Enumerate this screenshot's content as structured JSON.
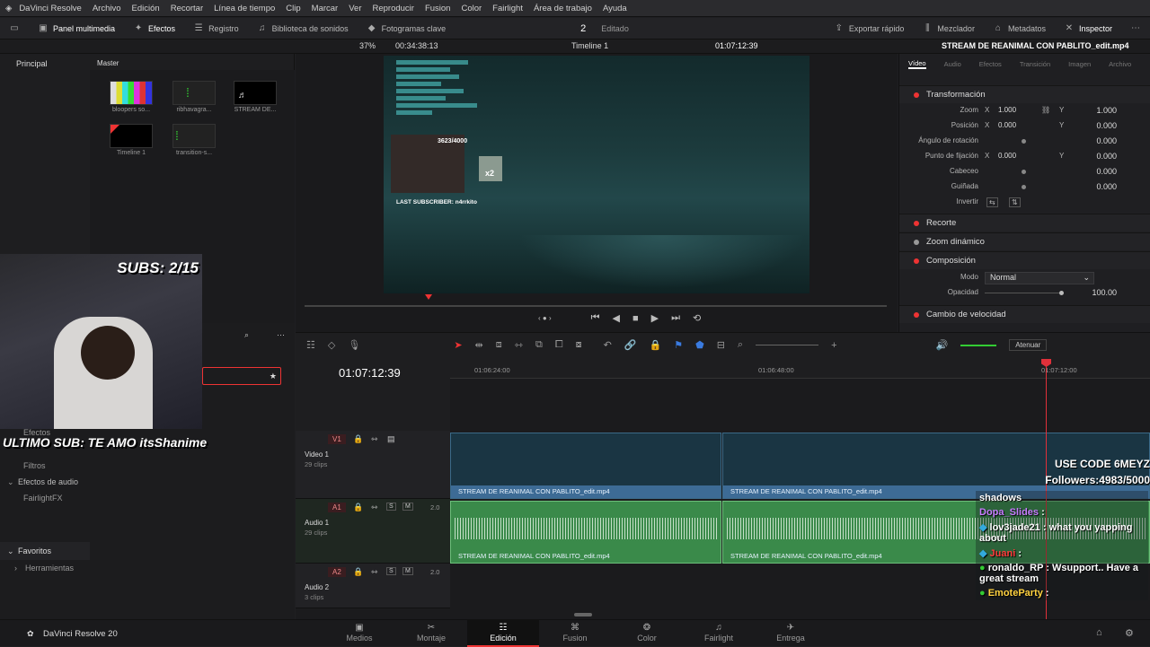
{
  "menu": [
    "DaVinci Resolve",
    "Archivo",
    "Edición",
    "Recortar",
    "Línea de tiempo",
    "Clip",
    "Marcar",
    "Ver",
    "Reproducir",
    "Fusion",
    "Color",
    "Fairlight",
    "Área de trabajo",
    "Ayuda"
  ],
  "toolbar": {
    "media_pool": "Panel multimedia",
    "effects": "Efectos",
    "log": "Registro",
    "sound_lib": "Biblioteca de sonidos",
    "keyframes": "Fotogramas clave",
    "count": "2",
    "status": "Editado",
    "quick_export": "Exportar rápido",
    "mixer": "Mezclador",
    "metadata": "Metadatos",
    "inspector": "Inspector"
  },
  "viewer": {
    "zoom": "37%",
    "duration": "00:34:38:13",
    "timeline_name": "Timeline 1",
    "timecode": "01:07:12:39",
    "clip_name": "STREAM DE REANIMAL CON PABLITO_edit.mp4"
  },
  "mediapool": {
    "tab_main": "Principal",
    "tab_master": "Master",
    "items": [
      "bloopers so...",
      "ribhavagra...",
      "STREAM DE...",
      "Timeline 1",
      "transition-s..."
    ]
  },
  "effects_panel": {
    "items": [
      "Efectos",
      "Filtros",
      "Efectos de audio",
      "FairlightFX"
    ],
    "favorites": "Favoritos",
    "tools": "Herramientas"
  },
  "inspector": {
    "tabs": [
      "Vídeo",
      "Audio",
      "Efectos",
      "Transición",
      "Imagen",
      "Archivo"
    ],
    "sections": {
      "transform": "Transformación",
      "crop": "Recorte",
      "dynamic_zoom": "Zoom dinámico",
      "composite": "Composición",
      "speed": "Cambio de velocidad"
    },
    "rows": {
      "zoom": "Zoom",
      "zoom_x": "1.000",
      "zoom_y": "1.000",
      "position": "Posición",
      "pos_x": "0.000",
      "pos_y": "0.000",
      "rotation": "Ángulo de rotación",
      "rot": "0.000",
      "anchor": "Punto de fijación",
      "anc_x": "0.000",
      "anc_y": "0.000",
      "pitch": "Cabeceo",
      "pitch_v": "0.000",
      "yaw": "Guiñada",
      "yaw_v": "0.000",
      "flip": "Invertir",
      "mode": "Modo",
      "mode_v": "Normal",
      "opacity": "Opacidad",
      "opacity_v": "100.00"
    }
  },
  "timeline": {
    "timecode": "01:07:12:39",
    "ruler": [
      "01:06:24:00",
      "01:06:48:00",
      "01:07:12:00"
    ],
    "v1": {
      "tag": "V1",
      "name": "Video 1",
      "clips": "29 clips"
    },
    "a1": {
      "tag": "A1",
      "name": "Audio 1",
      "clips": "29 clips",
      "level": "2.0"
    },
    "a2": {
      "tag": "A2",
      "name": "Audio 2",
      "clips": "3 clips",
      "level": "2.0"
    },
    "clip_label": "STREAM DE REANIMAL CON PABLITO_edit.mp4",
    "s_label": "S",
    "m_label": "M",
    "mute_btn": "Atenuar"
  },
  "overlay": {
    "subs": "SUBS: 2/15",
    "last_sub": "ULTIMO SUB: TE AMO itsShanime",
    "use_code": "USE CODE 6MEYZ",
    "followers": "Followers:4983/5000",
    "game_counter": "3623/4000",
    "game_last_sub": "LAST SUBSCRIBER: n4rrkito",
    "x2": "x2",
    "chat": [
      {
        "user": "shadows",
        "msg": "",
        "color": "#ffffff"
      },
      {
        "user": "Dopa_Slides",
        "msg": ":",
        "color": "#c77dff"
      },
      {
        "user": "lov3jade21",
        "msg": ": what you yapping about",
        "color": "#ffffff"
      },
      {
        "user": "Juani",
        "msg": ":",
        "color": "#ff3b3b"
      },
      {
        "user": "ronaldo_RP",
        "msg": ": Wsupport.. Have a great stream",
        "color": "#ffffff"
      },
      {
        "user": "EmoteParty",
        "msg": ":",
        "color": "#ffd23f"
      }
    ]
  },
  "pages": [
    "Medios",
    "Montaje",
    "Edición",
    "Fusion",
    "Color",
    "Fairlight",
    "Entrega"
  ],
  "brand": "DaVinci Resolve 20",
  "colors": {
    "accent": "#e33b3b",
    "clip_video": "#1a3543",
    "clip_audio": "#3a8a4a",
    "playhead": "#e0303a"
  }
}
